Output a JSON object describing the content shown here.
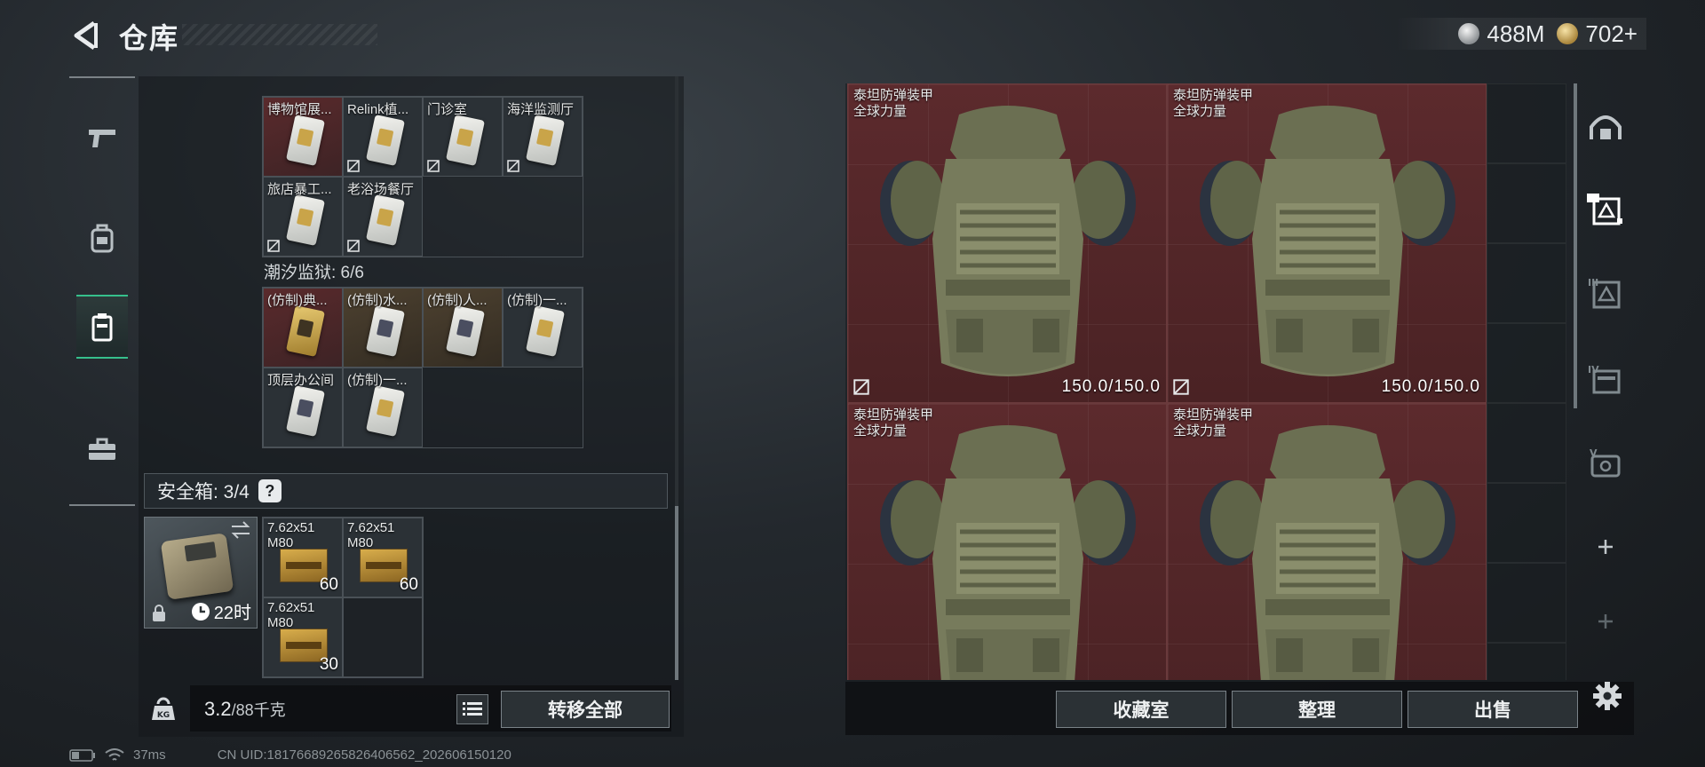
{
  "header": {
    "title": "仓库",
    "currency": [
      {
        "icon": "silver-coin-icon",
        "value": "488M"
      },
      {
        "icon": "gold-coin-icon",
        "value": "702+"
      }
    ]
  },
  "nav": [
    "weapon-icon",
    "backpack-icon",
    "container-icon",
    "toolbox-icon"
  ],
  "collections": [
    {
      "label": "",
      "items": [
        {
          "name": "博物馆展...",
          "bg": "red",
          "card": "white",
          "nosell": false
        },
        {
          "name": "Relink植...",
          "bg": "default",
          "card": "white",
          "nosell": true
        },
        {
          "name": "门诊室",
          "bg": "default",
          "card": "white",
          "nosell": true
        },
        {
          "name": "海洋监测厅",
          "bg": "default",
          "card": "white",
          "nosell": true
        },
        {
          "name": "旅店暴工...",
          "bg": "default",
          "card": "white",
          "nosell": true
        },
        {
          "name": "老浴场餐厅",
          "bg": "default",
          "card": "white",
          "nosell": true
        }
      ]
    },
    {
      "label": "潮汐监狱: 6/6",
      "items": [
        {
          "name": "(仿制)典...",
          "bg": "red",
          "card": "gold",
          "nosell": false
        },
        {
          "name": "(仿制)水...",
          "bg": "gold",
          "card": "dark",
          "nosell": false
        },
        {
          "name": "(仿制)人...",
          "bg": "gold",
          "card": "dark",
          "nosell": false
        },
        {
          "name": "(仿制)一...",
          "bg": "default",
          "card": "white",
          "nosell": false
        },
        {
          "name": "顶层办公间",
          "bg": "default",
          "card": "dark",
          "nosell": false
        },
        {
          "name": "(仿制)一...",
          "bg": "default",
          "card": "white",
          "nosell": false
        }
      ]
    }
  ],
  "safe": {
    "title": "安全箱: 3/4",
    "help": "?",
    "timer": "22时",
    "ammo": [
      {
        "name1": "7.62x51",
        "name2": "M80",
        "count": "60"
      },
      {
        "name1": "7.62x51",
        "name2": "M80",
        "count": "60"
      },
      {
        "name1": "7.62x51",
        "name2": "M80",
        "count": "30"
      }
    ]
  },
  "weight": {
    "current": "3.2",
    "capacity": "/88千克"
  },
  "buttons": {
    "transfer_all": "转移全部",
    "collection_room": "收藏室",
    "organize": "整理",
    "sell": "出售"
  },
  "status": {
    "ping": "37ms",
    "uid": "CN UID:18176689265826406562_202606150120"
  },
  "storage": [
    {
      "name1": "泰坦防弹装甲",
      "name2": "全球力量",
      "durability": "150.0/150.0"
    },
    {
      "name1": "泰坦防弹装甲",
      "name2": "全球力量",
      "durability": "150.0/150.0"
    },
    {
      "name1": "泰坦防弹装甲",
      "name2": "全球力量",
      "durability": ""
    },
    {
      "name1": "泰坦防弹装甲",
      "name2": "全球力量",
      "durability": ""
    }
  ],
  "tools": [
    "bunker-icon",
    "gift-case-icon",
    "case-iii-icon",
    "case-iv-icon",
    "case-v-icon",
    "plus-icon",
    "plus-icon"
  ],
  "colors": {
    "accent": "#36c08c",
    "red_item": "#5a2a2c",
    "gold_item": "#4d4130"
  }
}
